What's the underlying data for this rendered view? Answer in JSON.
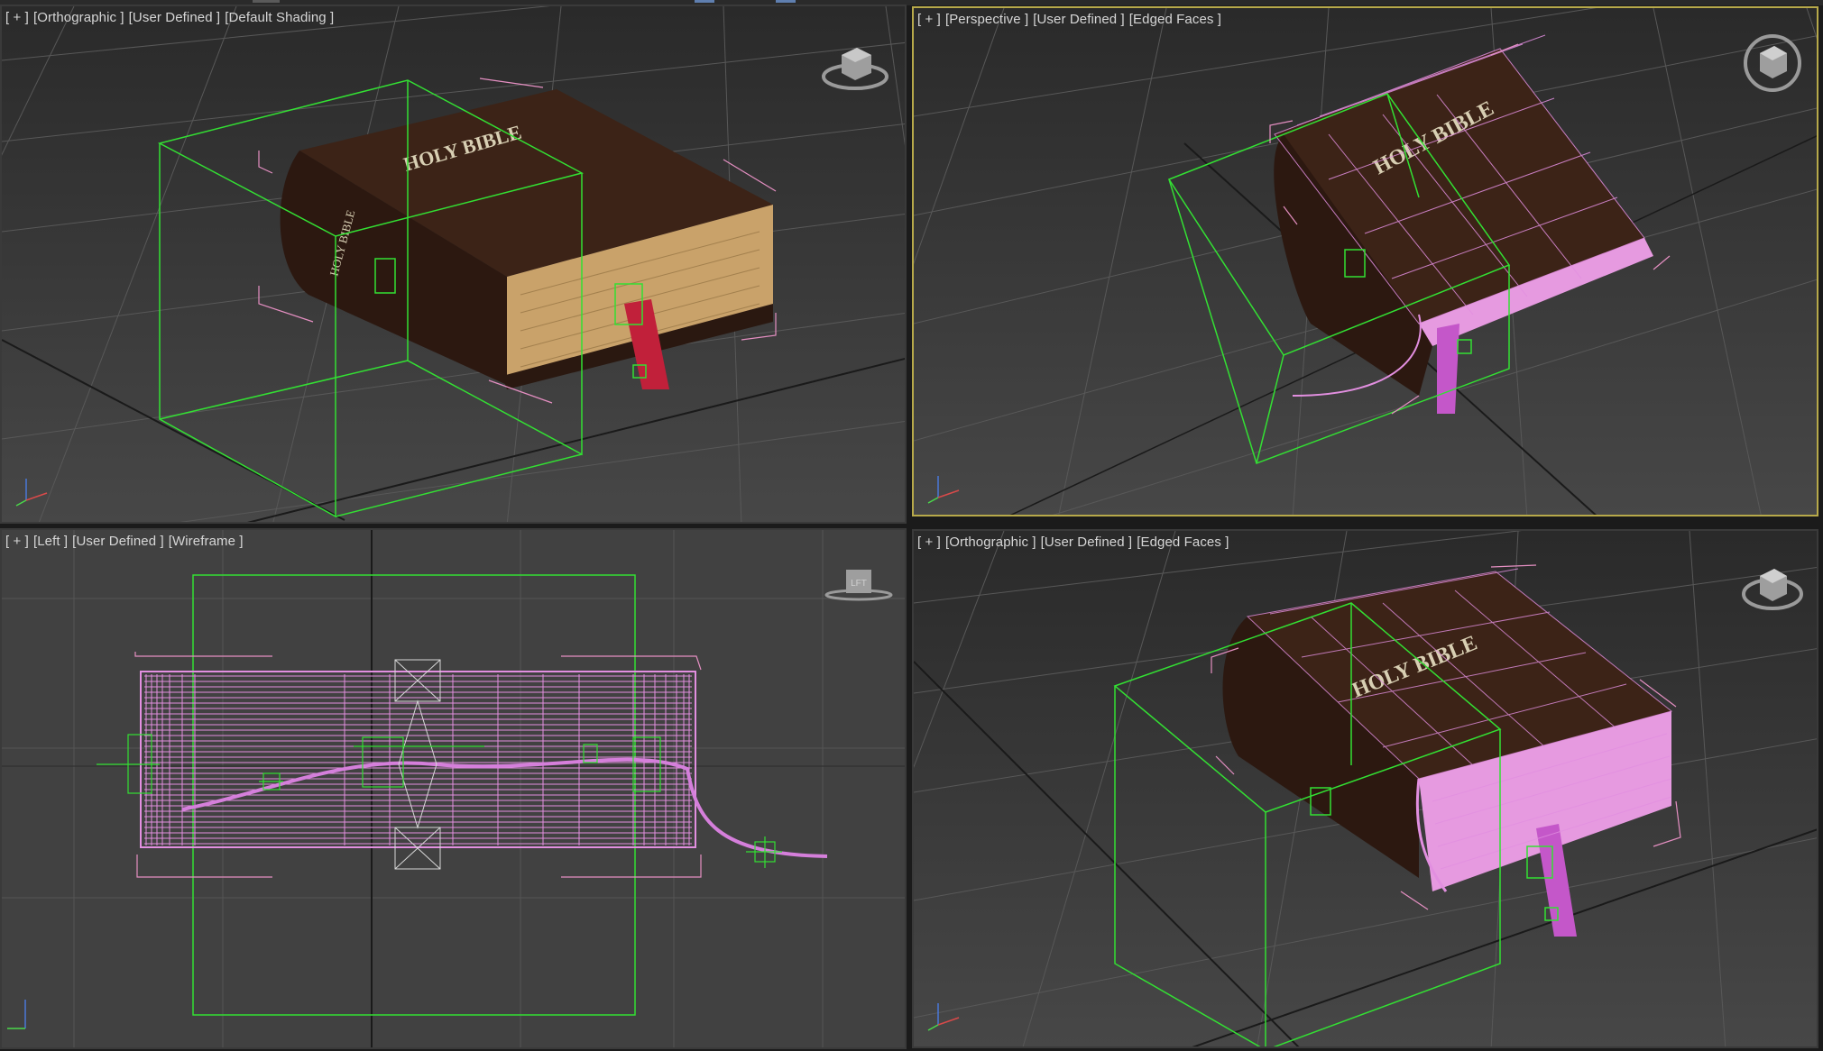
{
  "viewports": [
    {
      "id": "top-left",
      "label_parts": [
        "[ + ]",
        "[Orthographic ]",
        "[User Defined ]",
        "[Default Shading ]"
      ],
      "view": "Orthographic",
      "shading": "Default Shading",
      "book_title": "HOLY BIBLE",
      "spine_title": "HOLY BIBLE",
      "active": false
    },
    {
      "id": "top-right",
      "label_parts": [
        "[ + ]",
        "[Perspective ]",
        "[User Defined ]",
        "[Edged Faces ]"
      ],
      "view": "Perspective",
      "shading": "Edged Faces",
      "book_title": "HOLY BIBLE",
      "active": true
    },
    {
      "id": "bottom-left",
      "label_parts": [
        "[ + ]",
        "[Left ]",
        "[User Defined ]",
        "[Wireframe ]"
      ],
      "view": "Left",
      "shading": "Wireframe",
      "viewcube_face": "LFT",
      "active": false
    },
    {
      "id": "bottom-right",
      "label_parts": [
        "[ + ]",
        "[Orthographic ]",
        "[User Defined ]",
        "[Edged Faces ]"
      ],
      "view": "Orthographic",
      "shading": "Edged Faces",
      "book_title": "HOLY BIBLE",
      "active": false
    }
  ],
  "colors": {
    "selection_box": "#33e033",
    "bracket": "#e58fc2",
    "wire": "#e28fe0",
    "active_border": "#b7a94a",
    "grid": "#555555",
    "cover": "#3d2418",
    "pages": "#c9a26a",
    "ribbon": "#c1203a"
  },
  "icons": [
    "viewcube-icon",
    "axis-tripod-icon"
  ]
}
